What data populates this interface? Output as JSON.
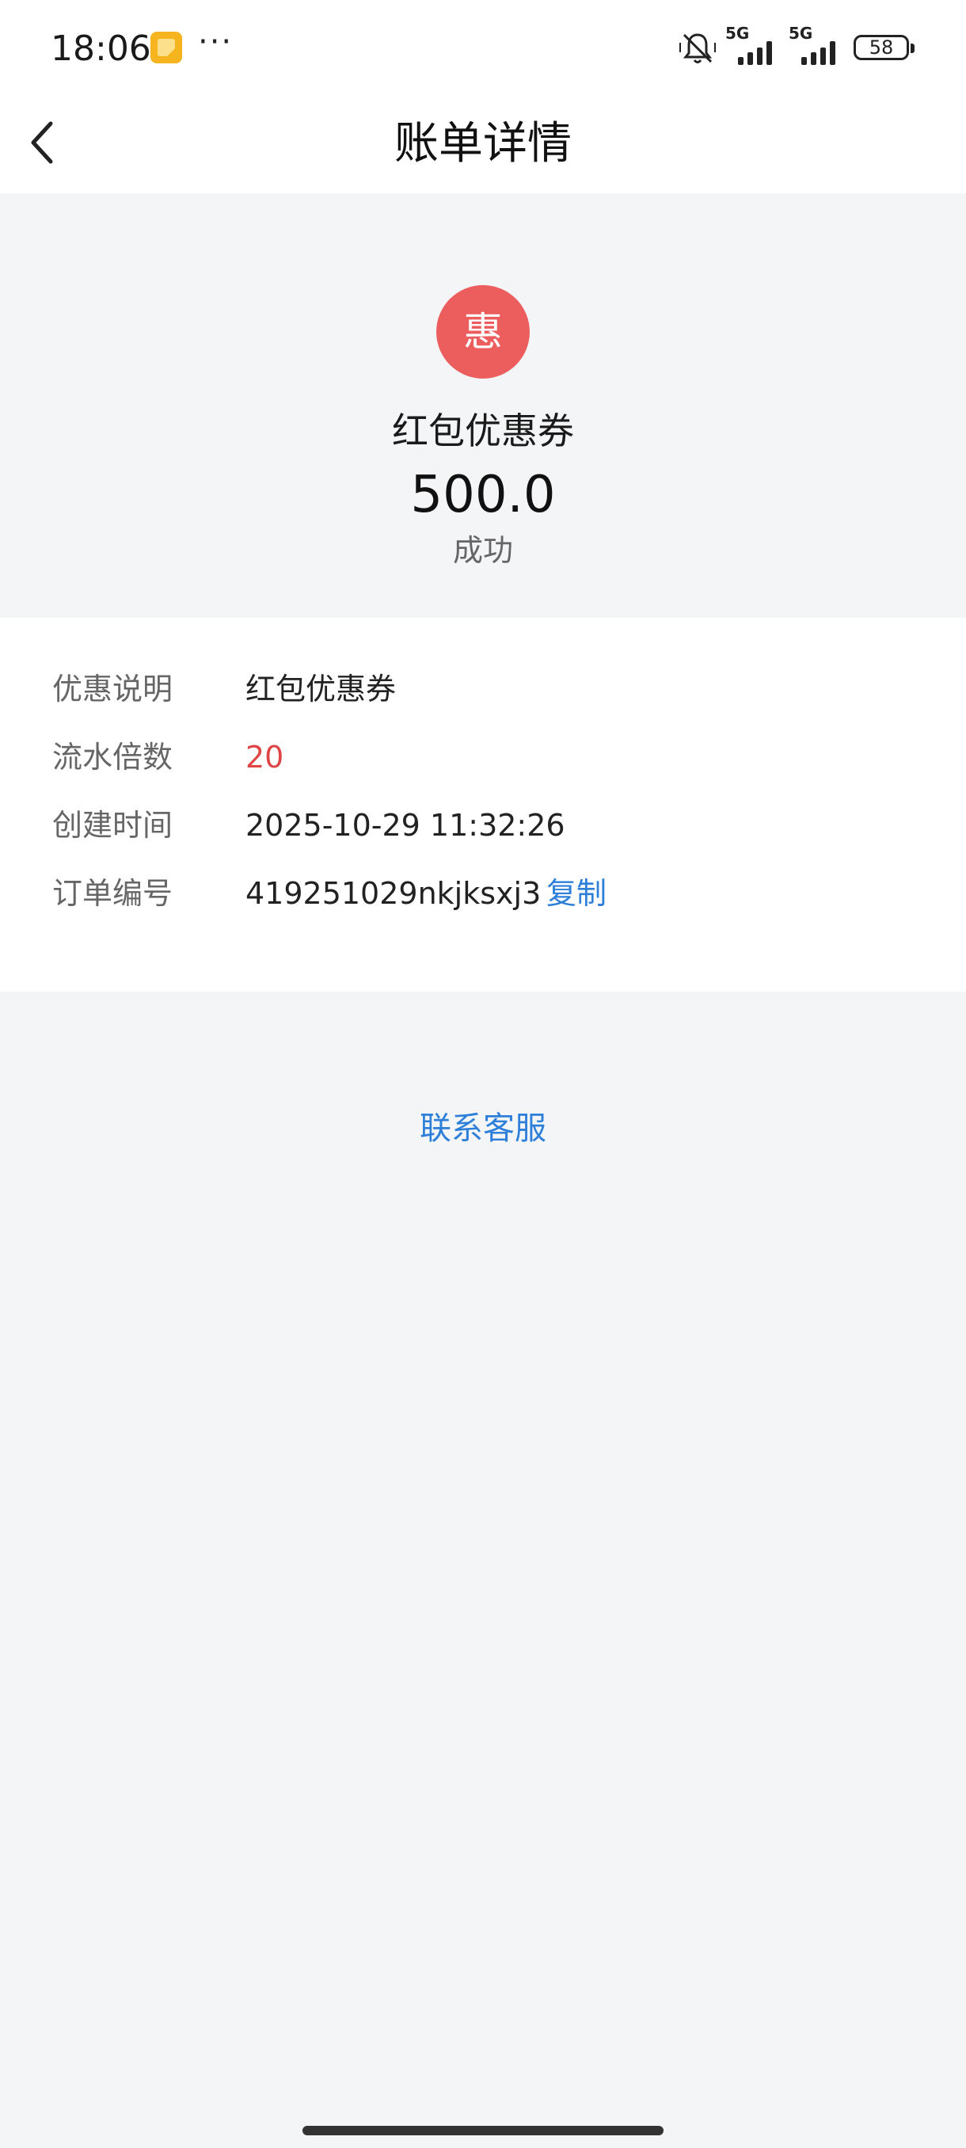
{
  "status_bar": {
    "time": "18:06",
    "more": "···",
    "signal_1_label": "5G",
    "signal_2_label": "5G",
    "battery": "58",
    "icons": [
      "app-notification-icon",
      "more-dots-icon",
      "mute-icon",
      "signal-5g-icon",
      "signal-5g-icon",
      "battery-icon"
    ]
  },
  "nav": {
    "title": "账单详情",
    "back_icon": "chevron-left-icon"
  },
  "summary": {
    "badge": "惠",
    "name": "红包优惠券",
    "amount": "500.0",
    "status": "成功",
    "badge_color": "#ec5d5d"
  },
  "details": [
    {
      "label": "优惠说明",
      "value": "红包优惠券"
    },
    {
      "label": "流水倍数",
      "value": "20"
    },
    {
      "label": "创建时间",
      "value": "2025-10-29 11:32:26"
    },
    {
      "label": "订单编号",
      "value": "419251029nkjksxj3"
    }
  ],
  "copy_label": "复制",
  "contact_label": "联系客服",
  "colors": {
    "accent": "#2d7fd9",
    "highlight": "#e04545",
    "page_bg": "#f4f5f7"
  }
}
